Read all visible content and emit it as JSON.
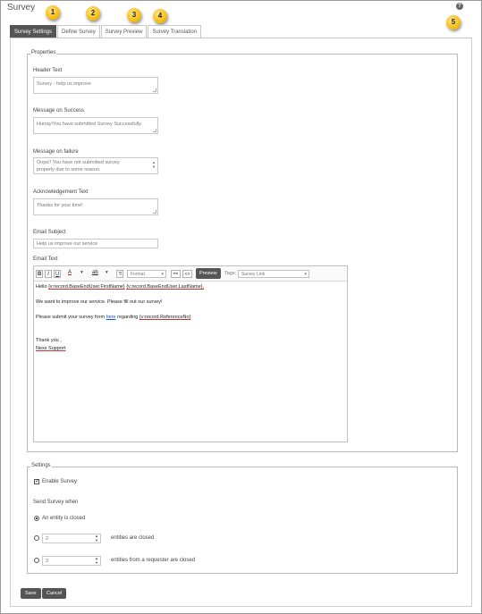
{
  "page": {
    "title": "Survey"
  },
  "tabs": [
    {
      "label": "Survey Settings",
      "callout": "1"
    },
    {
      "label": "Define Survey",
      "callout": "2"
    },
    {
      "label": "Survey Preview",
      "callout": "3"
    },
    {
      "label": "Survey Translation",
      "callout": "4"
    }
  ],
  "help": {
    "glyph": "?",
    "callout": "5"
  },
  "properties": {
    "legend": "Properties",
    "header_text": {
      "label": "Header Text",
      "value": "Survey - help us improve"
    },
    "message_success": {
      "label": "Message on Success",
      "value": "Hurray!You have submitted Survey Successfully."
    },
    "message_failure": {
      "label": "Message on failure",
      "line1": "Oops!! You have not submitted survey",
      "line2": "properly due to some reason."
    },
    "ack_text": {
      "label": "Acknowledgement Text",
      "value": "Thanks for your time!"
    },
    "email_subject": {
      "label": "Email Subject",
      "value": "Help us improve our service"
    },
    "email_text": {
      "label": "Email Text"
    }
  },
  "toolbar": {
    "bold": "B",
    "italic": "I",
    "underline": "U",
    "font_color": "A",
    "highlight": "ab",
    "format": "Format",
    "preview": "Preview",
    "tags_label": "Tags:",
    "tags_value": "Survey Link"
  },
  "email_body": {
    "hello": "Hello",
    "tag_first": "{v:record.BaseEndUser.FirstName}",
    "tag_last": "{v:record.BaseEndUser.LastName},",
    "line2": "We want to improve our service. Please fill out our survey!",
    "line3_pre": "Please submit your survey form",
    "line3_link": "here",
    "line3_mid": "regarding",
    "line3_tag": "{v:record.ReferenceNo}",
    "thanks": "Thank you ,",
    "signature": "Nexx Support"
  },
  "settings": {
    "legend": "Settings",
    "enable_survey": "Enable Survey",
    "send_when": "Send Survey when",
    "option_entity_closed": "An entity is closed",
    "option_count_closed_value": "2",
    "option_count_closed": "entities are closed",
    "option_requester_value": "3",
    "option_requester": "entities from a requester are closed"
  },
  "actions": {
    "save": "Save",
    "cancel": "Cancel"
  }
}
